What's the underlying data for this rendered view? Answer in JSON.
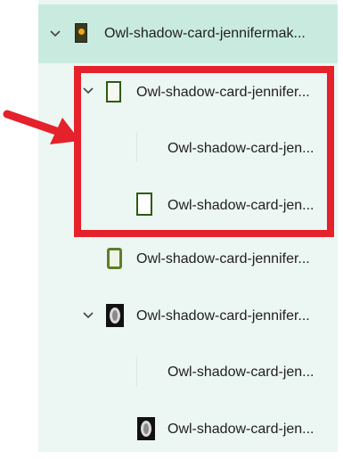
{
  "layers": [
    {
      "label": "Owl-shadow-card-jennifermak...",
      "selected": true
    },
    {
      "label": "Owl-shadow-card-jennifer..."
    },
    {
      "label": "Owl-shadow-card-jen..."
    },
    {
      "label": "Owl-shadow-card-jen..."
    },
    {
      "label": "Owl-shadow-card-jennifer..."
    },
    {
      "label": "Owl-shadow-card-jennifer..."
    },
    {
      "label": "Owl-shadow-card-jen..."
    },
    {
      "label": "Owl-shadow-card-jen..."
    }
  ],
  "icons": {
    "expand": "chevron-down-icon",
    "thumb_color_highlight": "#e5212b",
    "arrow_color": "#e5212b"
  }
}
